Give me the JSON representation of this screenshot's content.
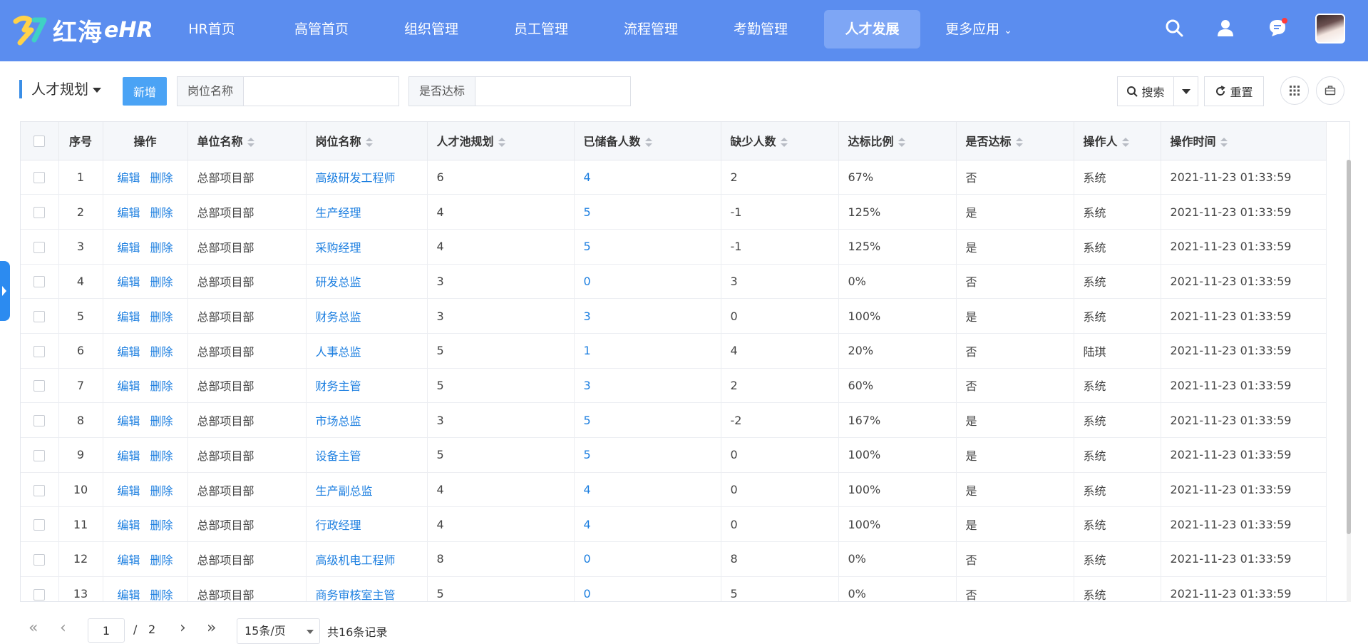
{
  "header": {
    "logo_text": "红海",
    "logo_sub": "eHR",
    "nav": [
      {
        "label": "HR首页",
        "active": false
      },
      {
        "label": "高管首页",
        "active": false
      },
      {
        "label": "组织管理",
        "active": false
      },
      {
        "label": "员工管理",
        "active": false
      },
      {
        "label": "流程管理",
        "active": false
      },
      {
        "label": "考勤管理",
        "active": false
      },
      {
        "label": "人才发展",
        "active": true
      },
      {
        "label": "更多应用",
        "active": false,
        "dropdown": true
      }
    ],
    "icons": [
      "search-icon",
      "user-icon",
      "message-icon",
      "avatar"
    ]
  },
  "toolbar": {
    "page_title": "人才规划",
    "add_label": "新增",
    "filter_position_label": "岗位名称",
    "filter_position_value": "",
    "filter_met_label": "是否达标",
    "filter_met_value": "",
    "search_label": "搜索",
    "reset_label": "重置"
  },
  "table": {
    "headers": {
      "index": "序号",
      "ops": "操作",
      "unit": "单位名称",
      "position": "岗位名称",
      "plan": "人才池规划",
      "reserved": "已储备人数",
      "shortage": "缺少人数",
      "ratio": "达标比例",
      "met": "是否达标",
      "operator": "操作人",
      "time": "操作时间"
    },
    "edit_label": "编辑",
    "delete_label": "删除",
    "rows": [
      {
        "index": "1",
        "unit": "总部项目部",
        "position": "高级研发工程师",
        "plan": "6",
        "reserved": "4",
        "shortage": "2",
        "ratio": "67%",
        "met": "否",
        "operator": "系统",
        "time": "2021-11-23 01:33:59"
      },
      {
        "index": "2",
        "unit": "总部项目部",
        "position": "生产经理",
        "plan": "4",
        "reserved": "5",
        "shortage": "-1",
        "ratio": "125%",
        "met": "是",
        "operator": "系统",
        "time": "2021-11-23 01:33:59"
      },
      {
        "index": "3",
        "unit": "总部项目部",
        "position": "采购经理",
        "plan": "4",
        "reserved": "5",
        "shortage": "-1",
        "ratio": "125%",
        "met": "是",
        "operator": "系统",
        "time": "2021-11-23 01:33:59"
      },
      {
        "index": "4",
        "unit": "总部项目部",
        "position": "研发总监",
        "plan": "3",
        "reserved": "0",
        "shortage": "3",
        "ratio": "0%",
        "met": "否",
        "operator": "系统",
        "time": "2021-11-23 01:33:59"
      },
      {
        "index": "5",
        "unit": "总部项目部",
        "position": "财务总监",
        "plan": "3",
        "reserved": "3",
        "shortage": "0",
        "ratio": "100%",
        "met": "是",
        "operator": "系统",
        "time": "2021-11-23 01:33:59"
      },
      {
        "index": "6",
        "unit": "总部项目部",
        "position": "人事总监",
        "plan": "5",
        "reserved": "1",
        "shortage": "4",
        "ratio": "20%",
        "met": "否",
        "operator": "陆琪",
        "time": "2021-11-23 01:33:59"
      },
      {
        "index": "7",
        "unit": "总部项目部",
        "position": "财务主管",
        "plan": "5",
        "reserved": "3",
        "shortage": "2",
        "ratio": "60%",
        "met": "否",
        "operator": "系统",
        "time": "2021-11-23 01:33:59"
      },
      {
        "index": "8",
        "unit": "总部项目部",
        "position": "市场总监",
        "plan": "3",
        "reserved": "5",
        "shortage": "-2",
        "ratio": "167%",
        "met": "是",
        "operator": "系统",
        "time": "2021-11-23 01:33:59"
      },
      {
        "index": "9",
        "unit": "总部项目部",
        "position": "设备主管",
        "plan": "5",
        "reserved": "5",
        "shortage": "0",
        "ratio": "100%",
        "met": "是",
        "operator": "系统",
        "time": "2021-11-23 01:33:59"
      },
      {
        "index": "10",
        "unit": "总部项目部",
        "position": "生产副总监",
        "plan": "4",
        "reserved": "4",
        "shortage": "0",
        "ratio": "100%",
        "met": "是",
        "operator": "系统",
        "time": "2021-11-23 01:33:59"
      },
      {
        "index": "11",
        "unit": "总部项目部",
        "position": "行政经理",
        "plan": "4",
        "reserved": "4",
        "shortage": "0",
        "ratio": "100%",
        "met": "是",
        "operator": "系统",
        "time": "2021-11-23 01:33:59"
      },
      {
        "index": "12",
        "unit": "总部项目部",
        "position": "高级机电工程师",
        "plan": "8",
        "reserved": "0",
        "shortage": "8",
        "ratio": "0%",
        "met": "否",
        "operator": "系统",
        "time": "2021-11-23 01:33:59"
      },
      {
        "index": "13",
        "unit": "总部项目部",
        "position": "商务审核室主管",
        "plan": "5",
        "reserved": "0",
        "shortage": "5",
        "ratio": "0%",
        "met": "否",
        "operator": "系统",
        "time": "2021-11-23 01:33:59"
      }
    ]
  },
  "pagination": {
    "current_page": "1",
    "separator": "/",
    "total_pages": "2",
    "page_size": "15条/页",
    "total_records": "共16条记录"
  },
  "colors": {
    "header_bg": "#5b8def",
    "link": "#1d7fe0",
    "add_button": "#4aa3f5"
  }
}
